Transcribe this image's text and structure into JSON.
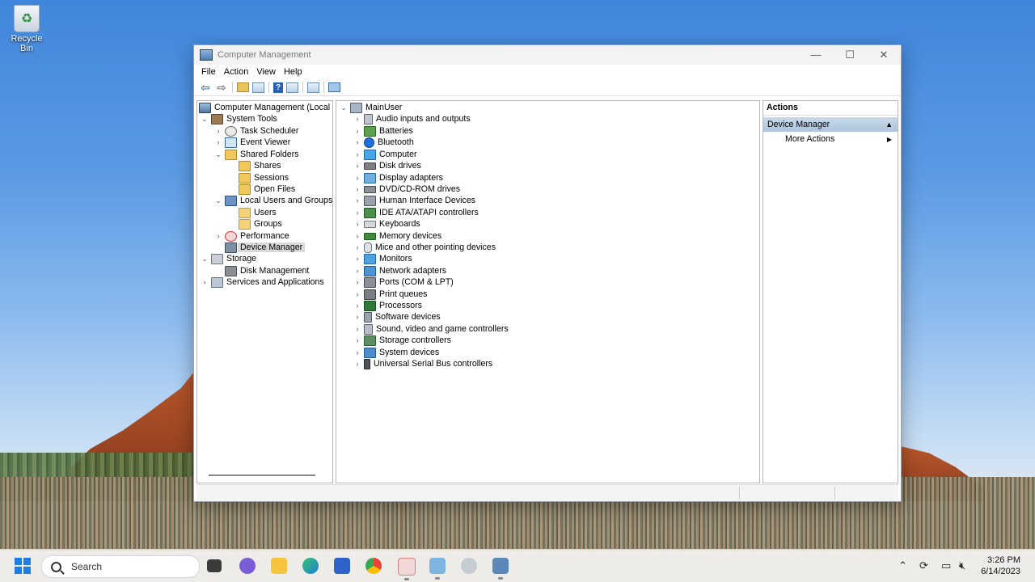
{
  "desktop": {
    "recycle_bin_label": "Recycle Bin"
  },
  "window": {
    "title": "Computer Management",
    "controls": {
      "minimize": "—",
      "maximize": "☐",
      "close": "✕"
    }
  },
  "menubar": [
    "File",
    "Action",
    "View",
    "Help"
  ],
  "left_tree": [
    {
      "label": "Computer Management (Local",
      "icon": "computer-management-icon",
      "twisty": ""
    },
    {
      "label": "System Tools",
      "icon": "tools-icon",
      "twisty": "⌄"
    },
    {
      "label": "Task Scheduler",
      "icon": "clock-icon",
      "twisty": "›"
    },
    {
      "label": "Event Viewer",
      "icon": "event-viewer-icon",
      "twisty": "›"
    },
    {
      "label": "Shared Folders",
      "icon": "shared-folder-icon",
      "twisty": "⌄"
    },
    {
      "label": "Shares",
      "icon": "shared-folder-icon",
      "twisty": ""
    },
    {
      "label": "Sessions",
      "icon": "shared-folder-icon",
      "twisty": ""
    },
    {
      "label": "Open Files",
      "icon": "shared-folder-icon",
      "twisty": ""
    },
    {
      "label": "Local Users and Groups",
      "icon": "users-icon",
      "twisty": "⌄"
    },
    {
      "label": "Users",
      "icon": "folder-icon",
      "twisty": ""
    },
    {
      "label": "Groups",
      "icon": "folder-icon",
      "twisty": ""
    },
    {
      "label": "Performance",
      "icon": "performance-icon",
      "twisty": "›"
    },
    {
      "label": "Device Manager",
      "icon": "device-manager-icon",
      "twisty": "",
      "selected": true
    },
    {
      "label": "Storage",
      "icon": "storage-icon",
      "twisty": "⌄"
    },
    {
      "label": "Disk Management",
      "icon": "disk-icon",
      "twisty": ""
    },
    {
      "label": "Services and Applications",
      "icon": "services-icon",
      "twisty": "›"
    }
  ],
  "device_tree": {
    "root": "MainUser",
    "categories": [
      "Audio inputs and outputs",
      "Batteries",
      "Bluetooth",
      "Computer",
      "Disk drives",
      "Display adapters",
      "DVD/CD-ROM drives",
      "Human Interface Devices",
      "IDE ATA/ATAPI controllers",
      "Keyboards",
      "Memory devices",
      "Mice and other pointing devices",
      "Monitors",
      "Network adapters",
      "Ports (COM & LPT)",
      "Print queues",
      "Processors",
      "Software devices",
      "Sound, video and game controllers",
      "Storage controllers",
      "System devices",
      "Universal Serial Bus controllers"
    ]
  },
  "actions_pane": {
    "header": "Actions",
    "section": "Device Manager",
    "more_actions": "More Actions"
  },
  "taskbar": {
    "search_placeholder": "Search",
    "time": "3:26 PM",
    "date": "6/14/2023"
  }
}
